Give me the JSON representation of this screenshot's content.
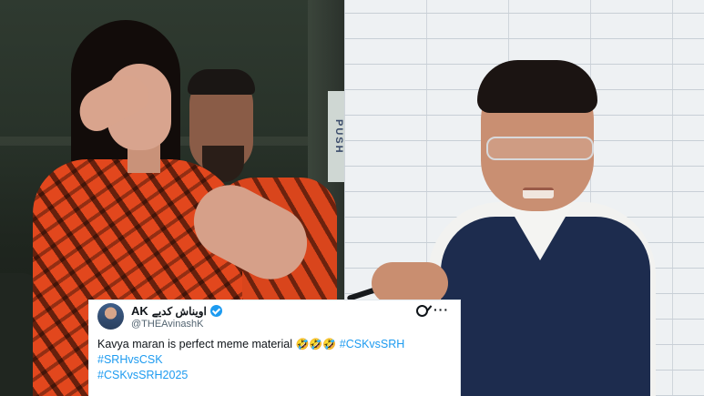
{
  "tweet": {
    "display_name": "AK",
    "urdu_name": "اویناش کدیے",
    "handle": "@THEAvinashK",
    "text": "Kavya maran is perfect meme material",
    "emojis": "🤣🤣🤣",
    "hashtags": [
      "#CSKvsSRH",
      "#SRHvsCSK",
      "#CSKvsSRH2025"
    ],
    "verified_color": "#1d9bf0",
    "hashtag_color": "#1d9bf0",
    "more_glyph": "···"
  },
  "left_photo": {
    "sign_text": "PUSH",
    "jersey_color": "#e2471d"
  },
  "right_photo": {
    "vest_color": "#1d2c4e"
  }
}
